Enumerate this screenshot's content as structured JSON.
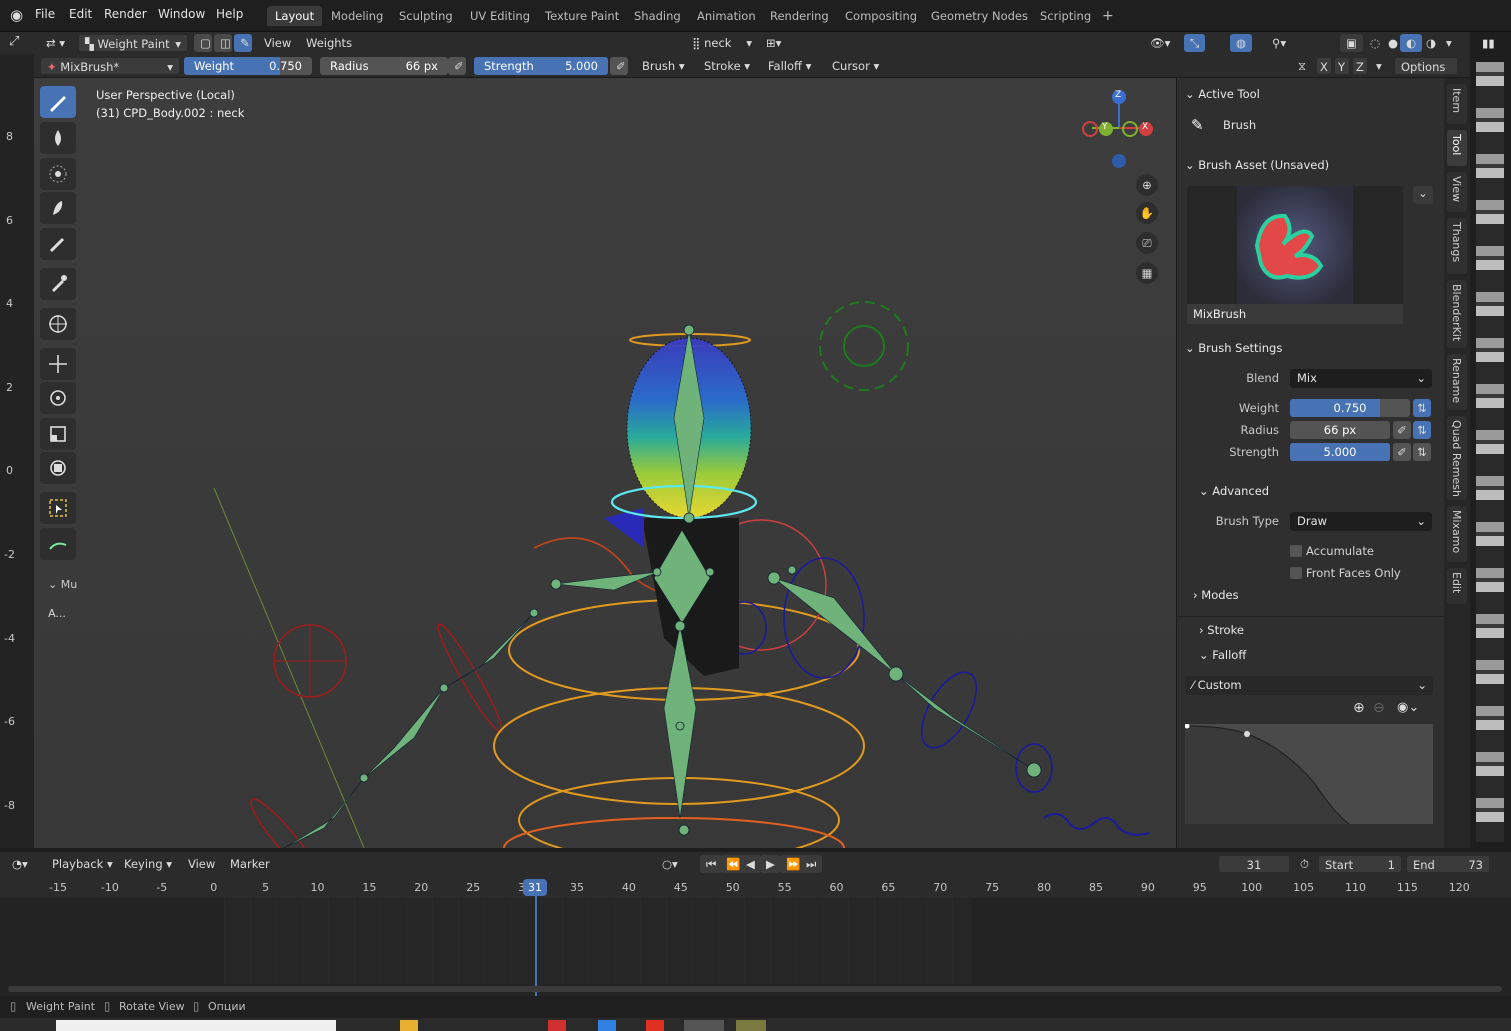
{
  "topbar": {
    "menus": [
      "File",
      "Edit",
      "Render",
      "Window",
      "Help"
    ],
    "workspaces": [
      "Layout",
      "Modeling",
      "Sculpting",
      "UV Editing",
      "Texture Paint",
      "Shading",
      "Animation",
      "Rendering",
      "Compositing",
      "Geometry Nodes",
      "Scripting"
    ],
    "active_workspace": "Layout",
    "add_tab": "+"
  },
  "header": {
    "mode": "Weight Paint",
    "view": "View",
    "weights": "Weights",
    "vertex_group": "neck"
  },
  "toolsettings": {
    "brush_name": "MixBrush*",
    "weight_label": "Weight",
    "weight_value": "0.750",
    "weight_fraction": 0.75,
    "radius_label": "Radius",
    "radius_value": "66 px",
    "strength_label": "Strength",
    "strength_value": "5.000",
    "strength_fraction": 1.0,
    "brush_menu": "Brush",
    "stroke_menu": "Stroke",
    "falloff_menu": "Falloff",
    "cursor_menu": "Cursor",
    "options_menu": "Options",
    "axes": [
      "X",
      "Y",
      "Z"
    ]
  },
  "viewport": {
    "perspective": "User Perspective (Local)",
    "object": "(31) CPD_Body.002 : neck",
    "gizmo_z": "Z",
    "gizmo_y": "Y",
    "gizmo_x": "X",
    "toolbar_collapse": "Mu",
    "toolbar_extra": "A..."
  },
  "ruler": [
    "8",
    "6",
    "4",
    "2",
    "0",
    "-2",
    "-4",
    "-6",
    "-8"
  ],
  "npanel": {
    "active_tool_title": "Active Tool",
    "active_tool_name": "Brush",
    "brush_asset_title": "Brush Asset (Unsaved)",
    "brush_asset_name": "MixBrush",
    "brush_settings_title": "Brush Settings",
    "blend_label": "Blend",
    "blend_value": "Mix",
    "weight_label": "Weight",
    "weight_value": "0.750",
    "weight_fraction": 0.75,
    "radius_label": "Radius",
    "radius_value": "66 px",
    "strength_label": "Strength",
    "strength_value": "5.000",
    "strength_fraction": 1.0,
    "advanced_title": "Advanced",
    "brush_type_label": "Brush Type",
    "brush_type_value": "Draw",
    "accumulate_label": "Accumulate",
    "front_faces_label": "Front Faces Only",
    "modes_title": "Modes",
    "stroke_title": "Stroke",
    "falloff_title": "Falloff",
    "falloff_preset": "Custom"
  },
  "ntabs": [
    "Item",
    "Tool",
    "View",
    "Thangs",
    "BlenderKit",
    "Rename",
    "Quad Remesh",
    "Mixamo",
    "Edit"
  ],
  "timeline": {
    "playback": "Playback",
    "keying": "Keying",
    "view": "View",
    "marker": "Marker",
    "current_frame": "31",
    "start_label": "Start",
    "start_value": "1",
    "end_label": "End",
    "end_value": "73",
    "ticks": [
      "-15",
      "-10",
      "-5",
      "0",
      "5",
      "10",
      "15",
      "20",
      "25",
      "30",
      "35",
      "40",
      "45",
      "50",
      "55",
      "60",
      "65",
      "70",
      "75",
      "80",
      "85",
      "90",
      "95",
      "100",
      "105",
      "110",
      "115",
      "120"
    ],
    "playhead_label": "31"
  },
  "statusbar": {
    "item1": "Weight Paint",
    "item2": "Rotate View",
    "item3": "Опции"
  },
  "colors": {
    "accent": "#4772b3",
    "bone": "#6fb27a",
    "ik_orange": "#e09a20"
  }
}
